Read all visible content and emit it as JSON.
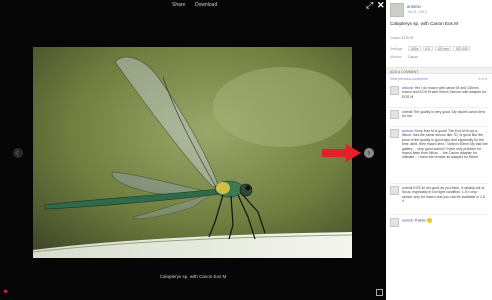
{
  "toolbar": {
    "share_label": "Share",
    "download_label": "Download",
    "expand_icon": "expand-icon",
    "close_icon": "close-icon"
  },
  "caption": "Calopteryx sp. with Canon Eos M",
  "nav": {
    "prev_icon": "chevron-left-icon",
    "next_icon": "chevron-right-icon"
  },
  "sidebar": {
    "owner": {
      "name": "antonio",
      "date": "Jul 21, 2013"
    },
    "title": "Calopteryx sp. with Canon Eos M",
    "camera": "Canon EOS M",
    "settings_label": "Settings",
    "settings": [
      "1/80s",
      "f/11",
      "100 mm",
      "ISO 400"
    ],
    "albums_label": "Albums",
    "albums_value": "Canon",
    "comments_header": "ADD A COMMENT",
    "view_previous": "View previous comments",
    "view_count": "5 of 8",
    "comments": [
      {
        "author": "antonio",
        "text": "Yes   I do macro with canon M and 100mm macro and EOS M with 50mm Tamron with adapter for EOS M"
      },
      {
        "author": "",
        "text": "overall The quality is very good. My favorit canon lens for me."
      },
      {
        "author": "antonio",
        "text": "Sorry Has M is good! The Eos M is not a Nikon. Has the same sensor like 7D, is good   But the price of the quality is good also and especially for the time used, then macro lens / Tamron 50mm   My last line gallery ... very good actionl! I have only problem for macro flash from Nikon ... the Canon adapter for ultimate... I have the remote as adapter for Nikon"
      },
      {
        "author": "",
        "text": "overall EOS-M not good as you think, it usually out of focus, especially in low light condition. 1.5 x crop sensor only for macro and you can be available in 1.5 x."
      },
      {
        "author": "antonio",
        "text": "Thanks  "
      }
    ]
  }
}
